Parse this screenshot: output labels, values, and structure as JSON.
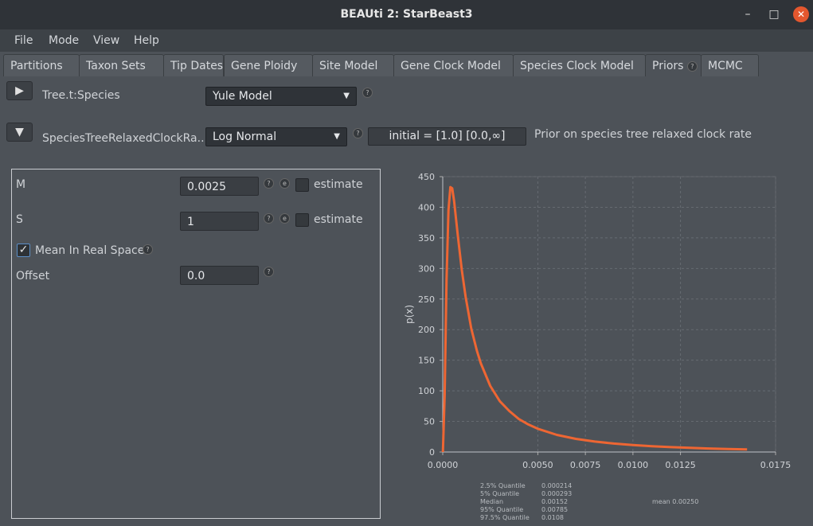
{
  "window": {
    "title": "BEAUti 2: StarBeast3"
  },
  "menu": [
    "File",
    "Mode",
    "View",
    "Help"
  ],
  "tabs": [
    "Partitions",
    "Taxon Sets",
    "Tip Dates",
    "Gene Ploidy",
    "Site Model",
    "Gene Clock Model",
    "Species Clock Model",
    "Priors",
    "MCMC"
  ],
  "active_tab": "Priors",
  "priors": [
    {
      "name": "Tree.t:Species",
      "distribution": "Yule Model"
    },
    {
      "name": "SpeciesTreeRelaxedClockRa...",
      "distribution": "Log Normal",
      "initial": "initial = [1.0] [0.0,∞]",
      "description": "Prior on species tree relaxed clock rate"
    }
  ],
  "params": {
    "m_label": "M",
    "m_value": "0.0025",
    "s_label": "S",
    "s_value": "1",
    "estimate_label": "estimate",
    "mean_real_space_label": "Mean In Real Space",
    "offset_label": "Offset",
    "offset_value": "0.0"
  },
  "icons": {
    "help": "?",
    "edit": "e"
  },
  "chart_data": {
    "type": "line",
    "ylabel": "p(x)",
    "xlabel": "",
    "xlim": [
      0,
      0.0175
    ],
    "ylim": [
      0,
      450
    ],
    "x_ticks": [
      "0.0000",
      "0.0050",
      "0.0075",
      "0.0100",
      "0.0125",
      "0.0175"
    ],
    "x_tick_values": [
      0,
      0.005,
      0.0075,
      0.01,
      0.0125,
      0.0175
    ],
    "y_ticks": [
      "0",
      "50",
      "100",
      "150",
      "200",
      "250",
      "300",
      "350",
      "400",
      "450"
    ],
    "y_tick_values": [
      0,
      50,
      100,
      150,
      200,
      250,
      300,
      350,
      400,
      450
    ],
    "grid": true,
    "series": [
      {
        "color": "#ee6633",
        "x": [
          1e-05,
          0.0001,
          0.0002,
          0.0003,
          0.0004,
          0.0005,
          0.0006,
          0.0007,
          0.0008,
          0.001,
          0.0012,
          0.0015,
          0.0018,
          0.002,
          0.0025,
          0.003,
          0.0035,
          0.004,
          0.0045,
          0.005,
          0.006,
          0.007,
          0.008,
          0.009,
          0.01,
          0.011,
          0.012,
          0.013,
          0.014,
          0.015,
          0.016
        ],
        "y": [
          0,
          92,
          282,
          395,
          433,
          431,
          410,
          381,
          352,
          298,
          254,
          202,
          165,
          145,
          108,
          83,
          67,
          54,
          45,
          38,
          28,
          21.5,
          17,
          13.8,
          11.3,
          9.4,
          7.9,
          6.7,
          5.7,
          4.9,
          4.3
        ]
      }
    ],
    "quantiles": [
      {
        "label": "2.5% Quantile",
        "value": "0.000214"
      },
      {
        "label": "5% Quantile",
        "value": "0.000293"
      },
      {
        "label": "Median",
        "value": "0.00152"
      },
      {
        "label": "95% Quantile",
        "value": "0.00785"
      },
      {
        "label": "97.5% Quantile",
        "value": "0.0108"
      }
    ],
    "mean_label": "mean 0.00250"
  }
}
